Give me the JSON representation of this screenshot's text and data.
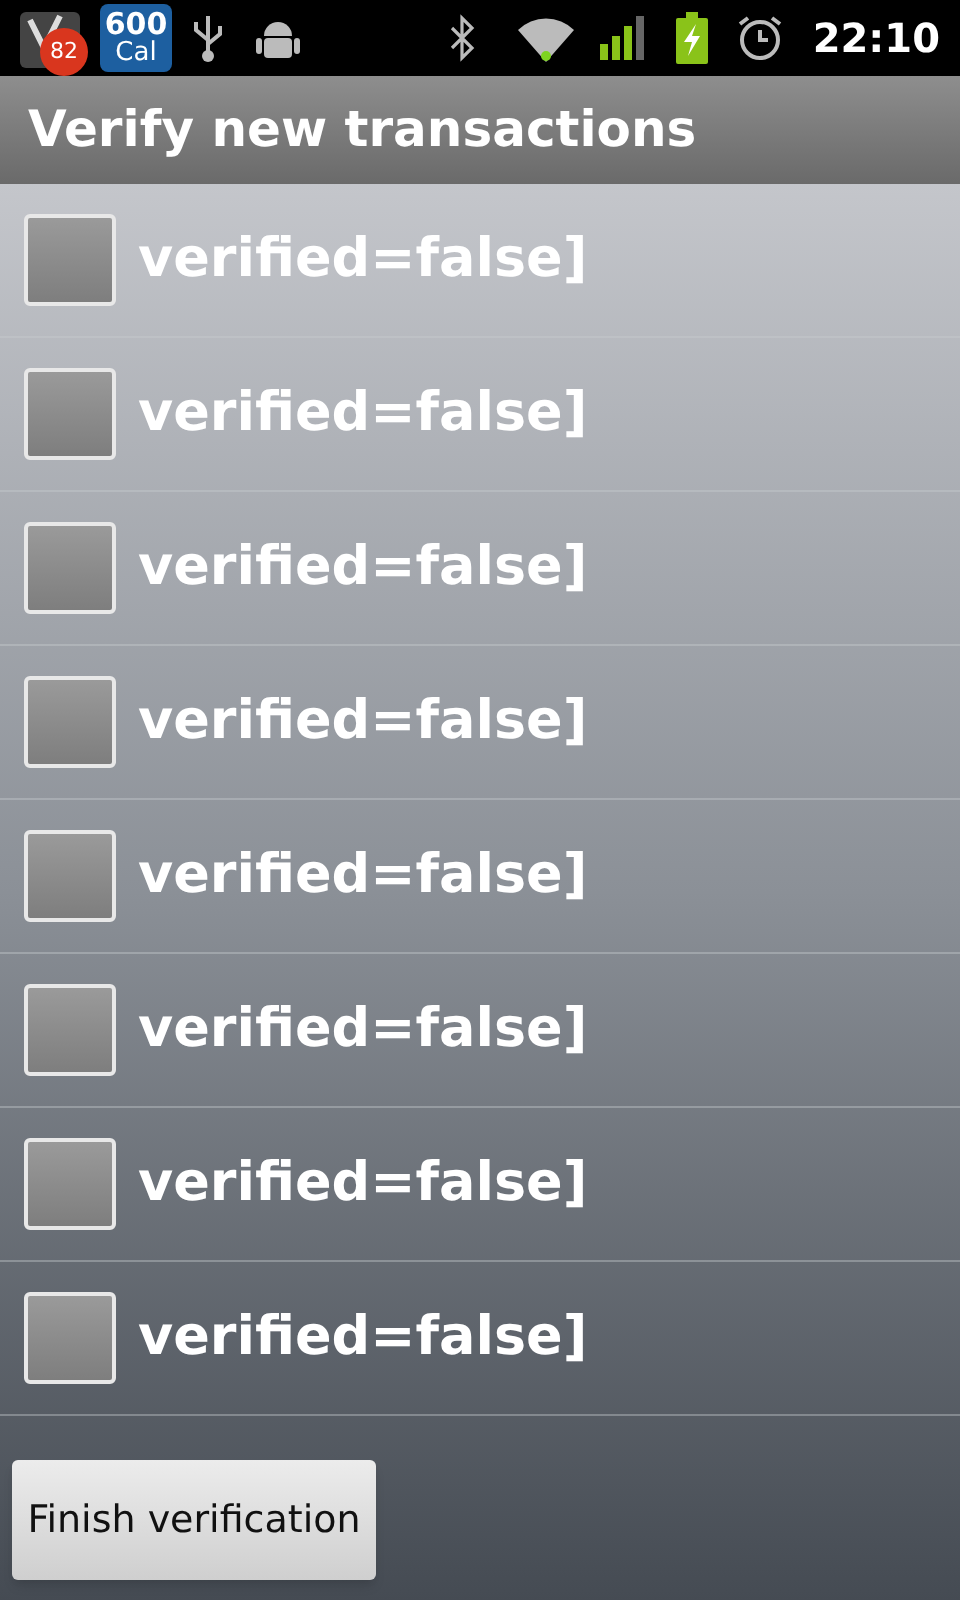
{
  "status_bar": {
    "app_badge": "82",
    "calorie_count": "600",
    "calorie_unit": "Cal",
    "time": "22:10"
  },
  "title": "Verify new transactions",
  "items": [
    {
      "label": "verified=false]",
      "checked": false
    },
    {
      "label": "verified=false]",
      "checked": false
    },
    {
      "label": "verified=false]",
      "checked": false
    },
    {
      "label": "verified=false]",
      "checked": false
    },
    {
      "label": "verified=false]",
      "checked": false
    },
    {
      "label": "verified=false]",
      "checked": false
    },
    {
      "label": "verified=false]",
      "checked": false
    },
    {
      "label": "verified=false]",
      "checked": false
    }
  ],
  "button": "Finish verification"
}
